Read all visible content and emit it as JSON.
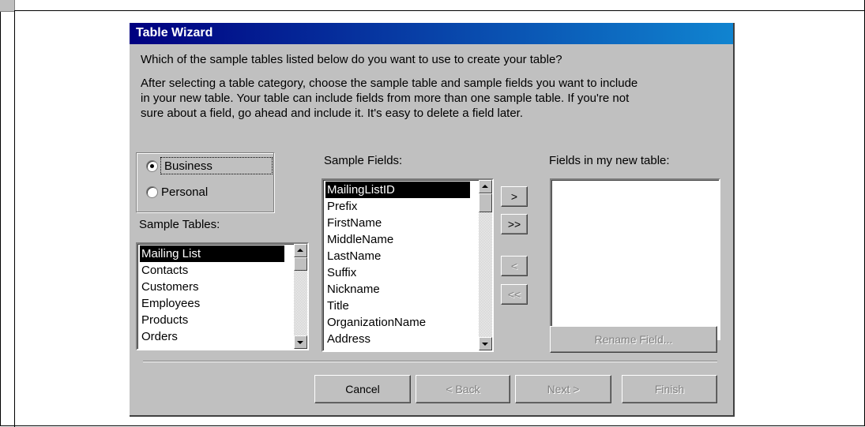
{
  "window": {
    "title": "Table Wizard"
  },
  "instructions": {
    "question": "Which of the sample tables listed below do you want to use to create your table?",
    "line1": "After selecting a table category, choose the sample table and sample fields you want to include",
    "line2": "in your new table. Your table can include fields from more than one sample table. If you're not",
    "line3": "sure about a field, go ahead and include it. It's easy to delete a field later."
  },
  "category": {
    "options": [
      "Business",
      "Personal"
    ],
    "selected": "Business"
  },
  "sample_tables": {
    "label": "Sample Tables:",
    "items": [
      "Mailing List",
      "Contacts",
      "Customers",
      "Employees",
      "Products",
      "Orders"
    ],
    "selected": "Mailing List"
  },
  "sample_fields": {
    "label": "Sample Fields:",
    "items": [
      "MailingListID",
      "Prefix",
      "FirstName",
      "MiddleName",
      "LastName",
      "Suffix",
      "Nickname",
      "Title",
      "OrganizationName",
      "Address"
    ],
    "selected": "MailingListID"
  },
  "transfer_buttons": {
    "add_one": ">",
    "add_all": ">>",
    "remove_one": "<",
    "remove_all": "<<"
  },
  "new_table": {
    "label": "Fields in my new table:",
    "items": []
  },
  "rename_button": "Rename Field...",
  "footer": {
    "cancel": "Cancel",
    "back": "< Back",
    "next": "Next >",
    "finish": "Finish"
  }
}
